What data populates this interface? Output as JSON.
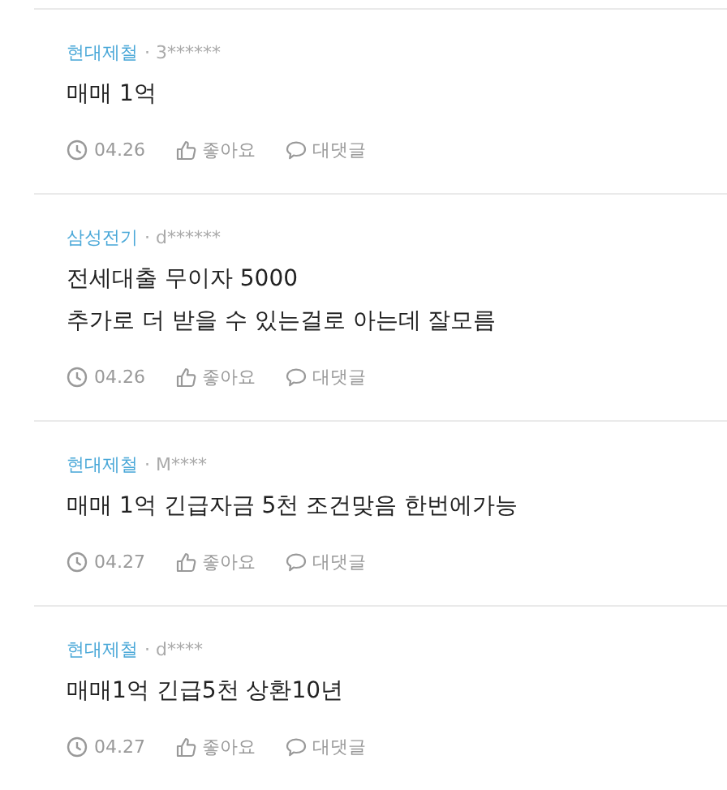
{
  "posts": [
    {
      "company": "현대제철",
      "author": "· 3******",
      "body": [
        "매매 1억"
      ],
      "date": "04.26",
      "like_label": "좋아요",
      "reply_label": "대댓글"
    },
    {
      "company": "삼성전기",
      "author": "· d******",
      "body": [
        "전세대출 무이자 5000",
        "추가로 더 받을 수 있는걸로 아는데 잘모름"
      ],
      "date": "04.26",
      "like_label": "좋아요",
      "reply_label": "대댓글"
    },
    {
      "company": "현대제철",
      "author": "· M****",
      "body": [
        "매매 1억 긴급자금 5천 조건맞음 한번에가능"
      ],
      "date": "04.27",
      "like_label": "좋아요",
      "reply_label": "대댓글"
    },
    {
      "company": "현대제철",
      "author": "· d****",
      "body": [
        "매매1억 긴급5천 상환10년"
      ],
      "date": "04.27",
      "like_label": "좋아요",
      "reply_label": "대댓글"
    }
  ]
}
